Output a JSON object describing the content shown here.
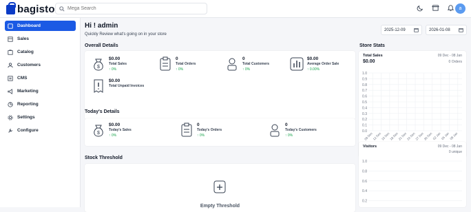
{
  "header": {
    "brand": "bagisto",
    "search_placeholder": "Mega Search",
    "avatar_initial": "a"
  },
  "sidebar": {
    "items": [
      {
        "label": "Dashboard",
        "icon": "dashboard-icon",
        "active": true
      },
      {
        "label": "Sales",
        "icon": "sales-icon"
      },
      {
        "label": "Catalog",
        "icon": "catalog-icon"
      },
      {
        "label": "Customers",
        "icon": "customers-icon"
      },
      {
        "label": "CMS",
        "icon": "cms-icon"
      },
      {
        "label": "Marketing",
        "icon": "marketing-icon"
      },
      {
        "label": "Reporting",
        "icon": "reporting-icon"
      },
      {
        "label": "Settings",
        "icon": "settings-icon"
      },
      {
        "label": "Configure",
        "icon": "configure-icon"
      }
    ]
  },
  "main": {
    "greeting": "Hi ! admin",
    "subtitle": "Quickly Review what's going on in your store",
    "date_from": "2025-12-09",
    "date_to": "2026-01-08",
    "overall": {
      "title": "Overall Details",
      "stats": [
        {
          "value": "$0.00",
          "label": "Total Sales",
          "change": "↑ 0%"
        },
        {
          "value": "0",
          "label": "Total Orders",
          "change": "↑ 0%"
        },
        {
          "value": "0",
          "label": "Total Customers",
          "change": "↑ 0%"
        },
        {
          "value": "$0.00",
          "label": "Average Order Sale",
          "change": "↑ 0.00%"
        },
        {
          "value": "$0.00",
          "label": "Total Unpaid Invoices",
          "change": ""
        }
      ]
    },
    "today": {
      "title": "Today's Details",
      "stats": [
        {
          "value": "$0.00",
          "label": "Today's Sales",
          "change": "↑ 0%"
        },
        {
          "value": "0",
          "label": "Today's Orders",
          "change": "↑ 0%"
        },
        {
          "value": "0",
          "label": "Today's Customers",
          "change": "↑ 0%"
        }
      ]
    },
    "stock": {
      "title": "Stock Threshold",
      "empty": "Empty Threshold"
    }
  },
  "store_stats": {
    "title": "Store Stats",
    "sales": {
      "title": "Total Sales",
      "range": "09 Dec - 08 Jan",
      "value": "$0.00",
      "orders": "0 Orders"
    },
    "visitors": {
      "title": "Visitors",
      "range": "09 Dec - 08 Jan",
      "unique": "0 unique"
    }
  },
  "chart_data": [
    {
      "type": "bar",
      "title": "Total Sales",
      "categories": [
        "09 Dec",
        "12 Dec",
        "15 Dec",
        "18 Dec",
        "21 Dec",
        "24 Dec",
        "27 Dec",
        "30 Dec",
        "02 Jan",
        "05 Jan",
        "08 Jan"
      ],
      "values": [
        0,
        0,
        0,
        0,
        0,
        0,
        0,
        0,
        0,
        0,
        0
      ],
      "ylim": [
        0,
        1.0
      ],
      "yticks": [
        "0.0",
        "0.1",
        "0.2",
        "0.3",
        "0.4",
        "0.5",
        "0.6",
        "0.7",
        "0.8",
        "0.9",
        "1.0"
      ],
      "grid": true
    },
    {
      "type": "bar",
      "title": "Visitors",
      "ylim": [
        0,
        1.0
      ],
      "yticks": [
        "0.2",
        "0.4",
        "0.6",
        "0.8",
        "1.0"
      ],
      "grid": true
    }
  ]
}
